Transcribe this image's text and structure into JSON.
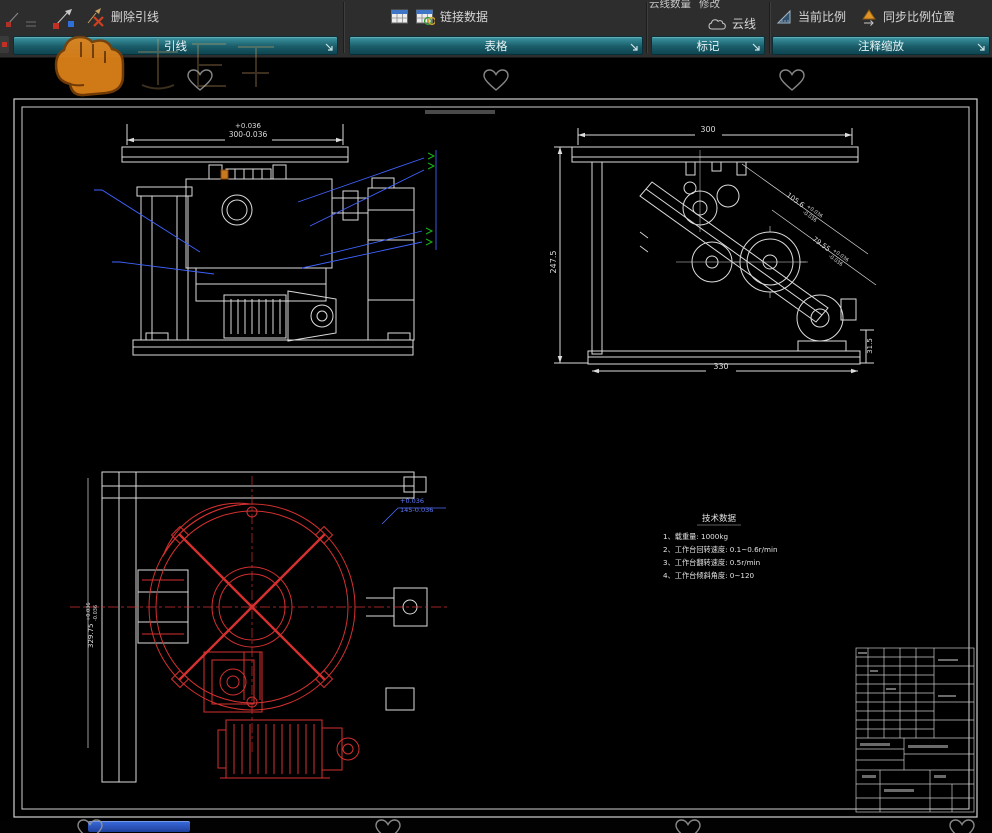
{
  "ribbon": {
    "buttons": {
      "delete_leader": "删除引线",
      "link_data": "链接数据",
      "cloud_count": "云线数量",
      "modify": "修改",
      "cloud": "云线",
      "current_scale": "当前比例",
      "sync_scale_position": "同步比例位置"
    },
    "panels": {
      "leader": "引线",
      "table": "表格",
      "markup": "标记",
      "annotation_scaling": "注释缩放"
    }
  },
  "drawing": {
    "front_view": {
      "dim_width": {
        "plus": "+0.036",
        "value": "300-0.036"
      }
    },
    "side_view": {
      "dim_top": "300",
      "dim_left": "247.5",
      "dim_bottom": "330",
      "dim_right": "31.5",
      "dim_diag1": {
        "value": "105.6",
        "plus": "+0.036",
        "minus": "-0.036"
      },
      "dim_diag2": {
        "value": "79.55",
        "plus": "+0.036",
        "minus": "-0.036"
      }
    },
    "top_view": {
      "dim_right": {
        "plus": "+0.036",
        "value": "145-0.036"
      },
      "dim_left": {
        "value": "329.75",
        "plus": "+0.036",
        "minus": "-0.036"
      }
    },
    "tech_data": {
      "title": "技术数据",
      "items": [
        "1、载重量: 1000kg",
        "2、工作台回转速度: 0.1~0.6r/min",
        "3、工作台翻转速度: 0.5r/min",
        "4、工作台倾斜角度: 0~120"
      ]
    }
  }
}
